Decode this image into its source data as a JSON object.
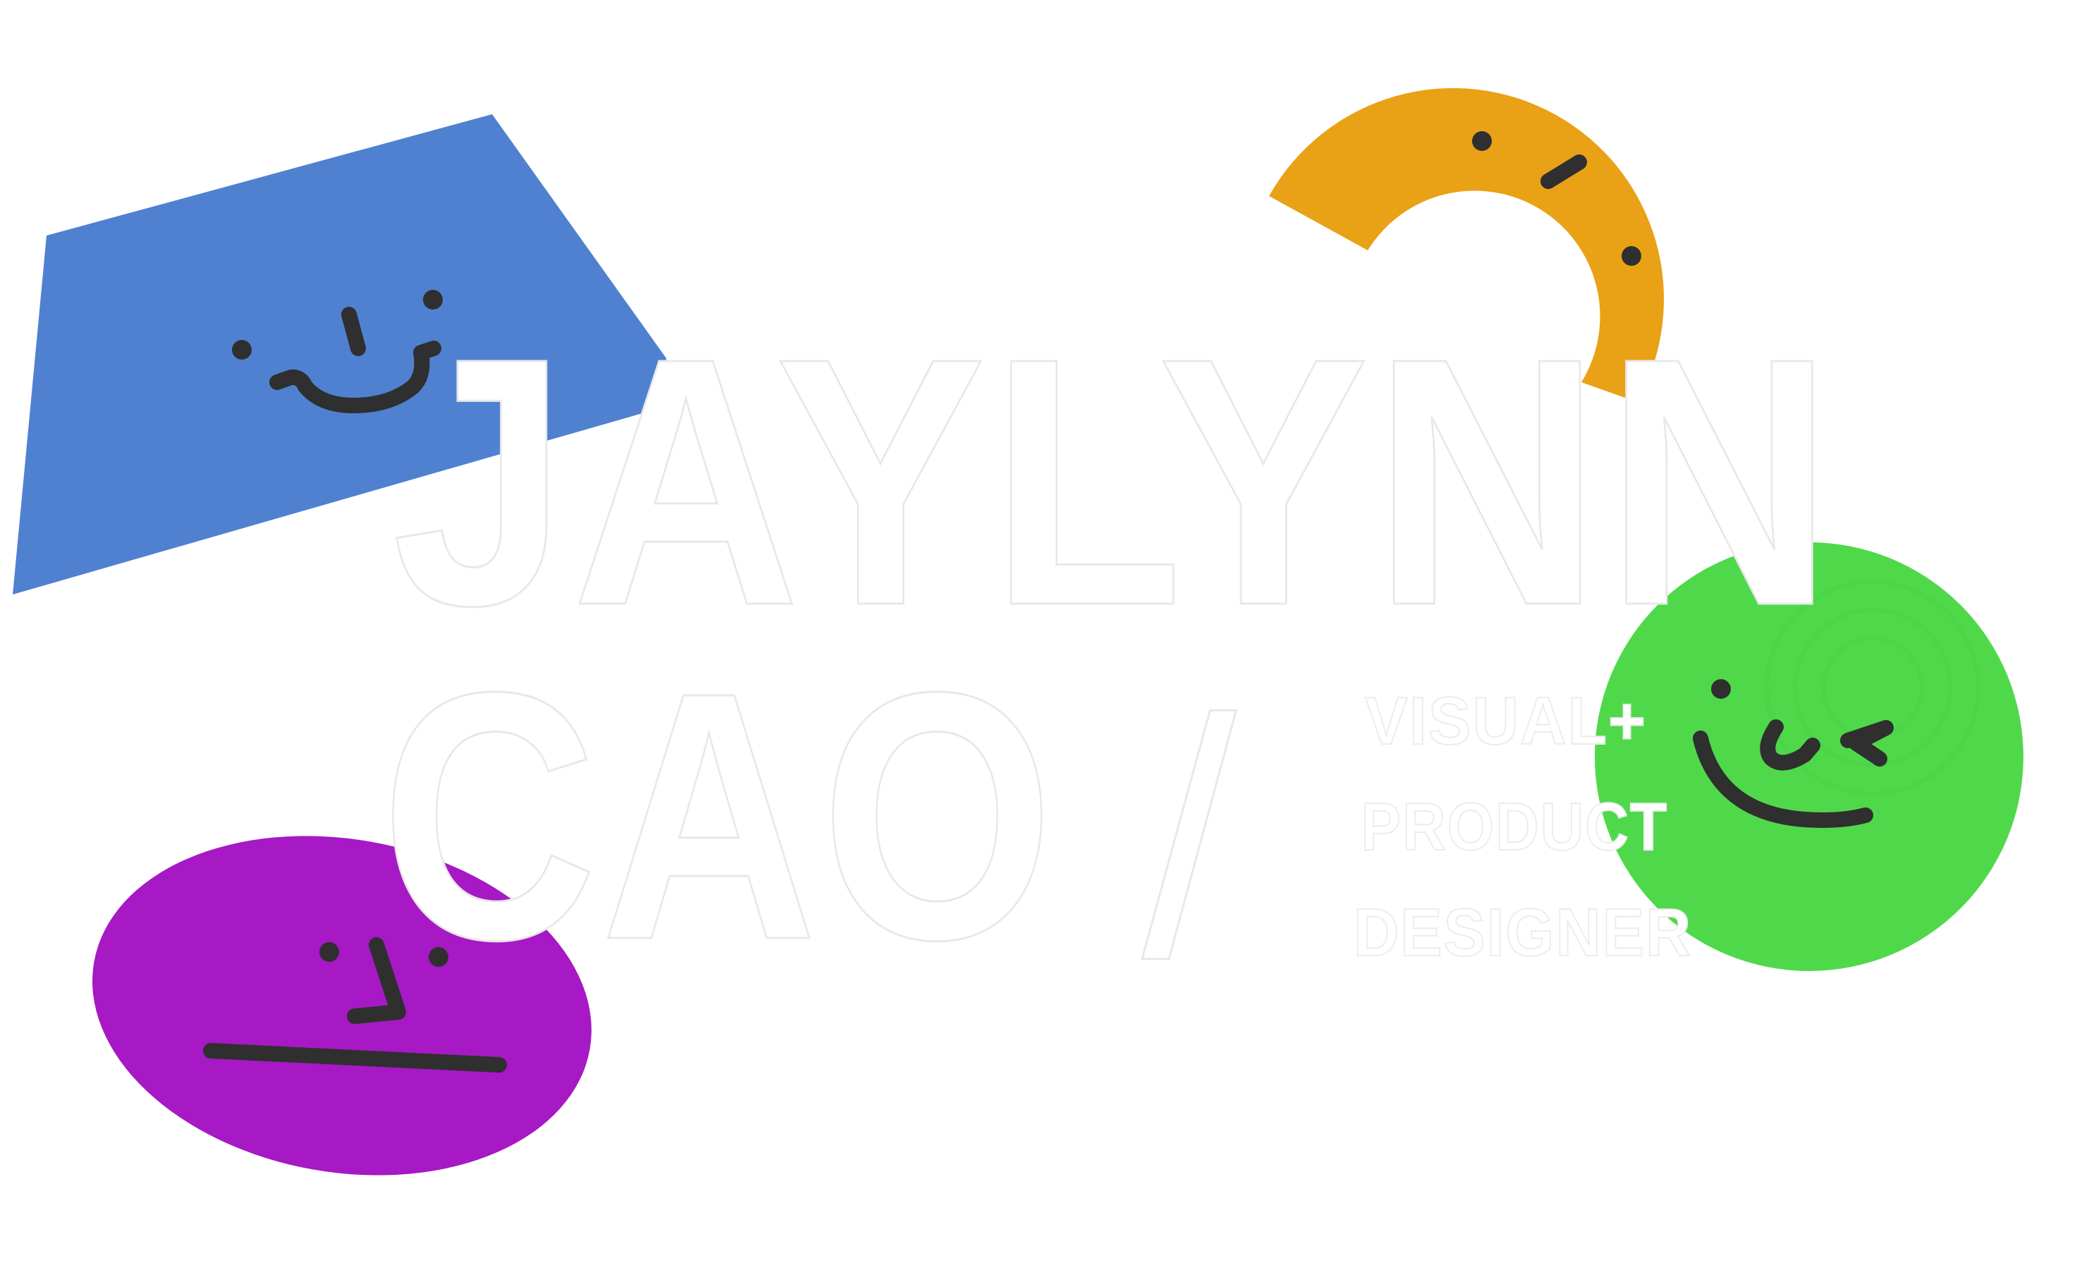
{
  "hero": {
    "first_name": "JAYLYNN",
    "last_name": "CAO",
    "separator": "/",
    "role_line_1": "VISUAL+",
    "role_line_2": "PRODUCT",
    "role_line_3": "DESIGNER"
  },
  "shapes": [
    {
      "name": "blue-quad-face-icon",
      "color": "#4f81d0"
    },
    {
      "name": "orange-arc-face-icon",
      "color": "#e9a115"
    },
    {
      "name": "green-circle-face-icon",
      "color": "#4fd94a"
    },
    {
      "name": "purple-ellipse-face-icon",
      "color": "#a619c4"
    }
  ],
  "colors": {
    "background": "#ffffff",
    "face_ink": "#2f2f2f",
    "headline_fill": "#ffffff"
  }
}
